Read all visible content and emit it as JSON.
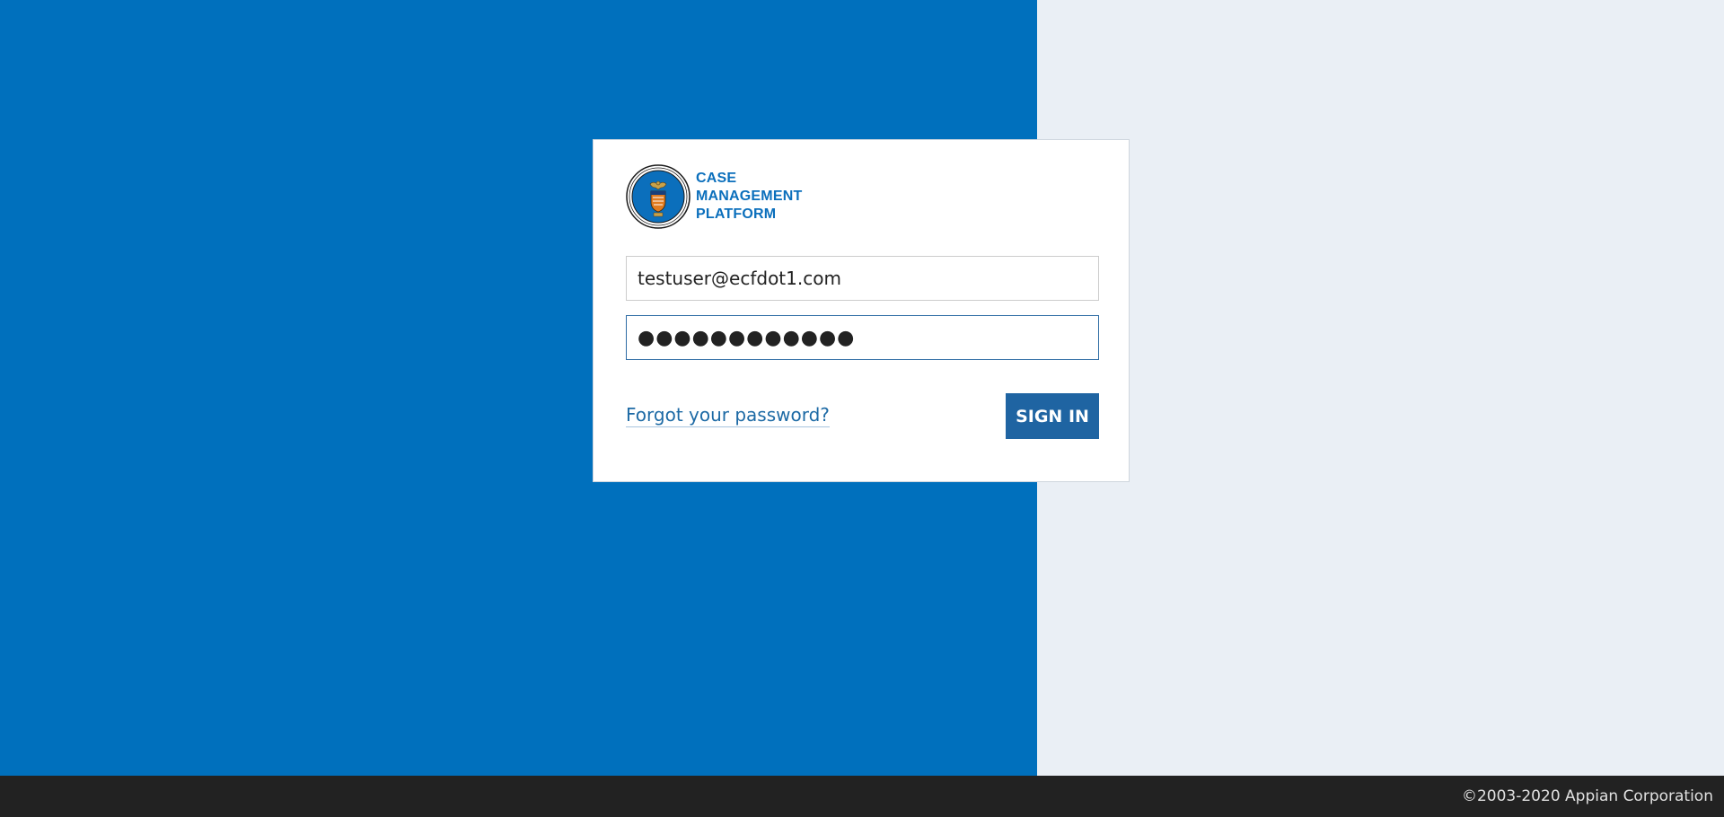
{
  "login": {
    "brand_lines": [
      "CASE",
      "MANAGEMENT",
      "PLATFORM"
    ],
    "username_value": "testuser@ecfdot1.com",
    "password_masked": "●●●●●●●●●●●●",
    "forgot_password_label": "Forgot your password?",
    "sign_in_label": "SIGN IN"
  },
  "footer": {
    "copyright": "©2003-2020 Appian Corporation"
  },
  "colors": {
    "left_background": "#0070bd",
    "right_background": "#eaeff5",
    "brand_text": "#0b6fbc",
    "button": "#1f64a2",
    "footer": "#222222"
  }
}
